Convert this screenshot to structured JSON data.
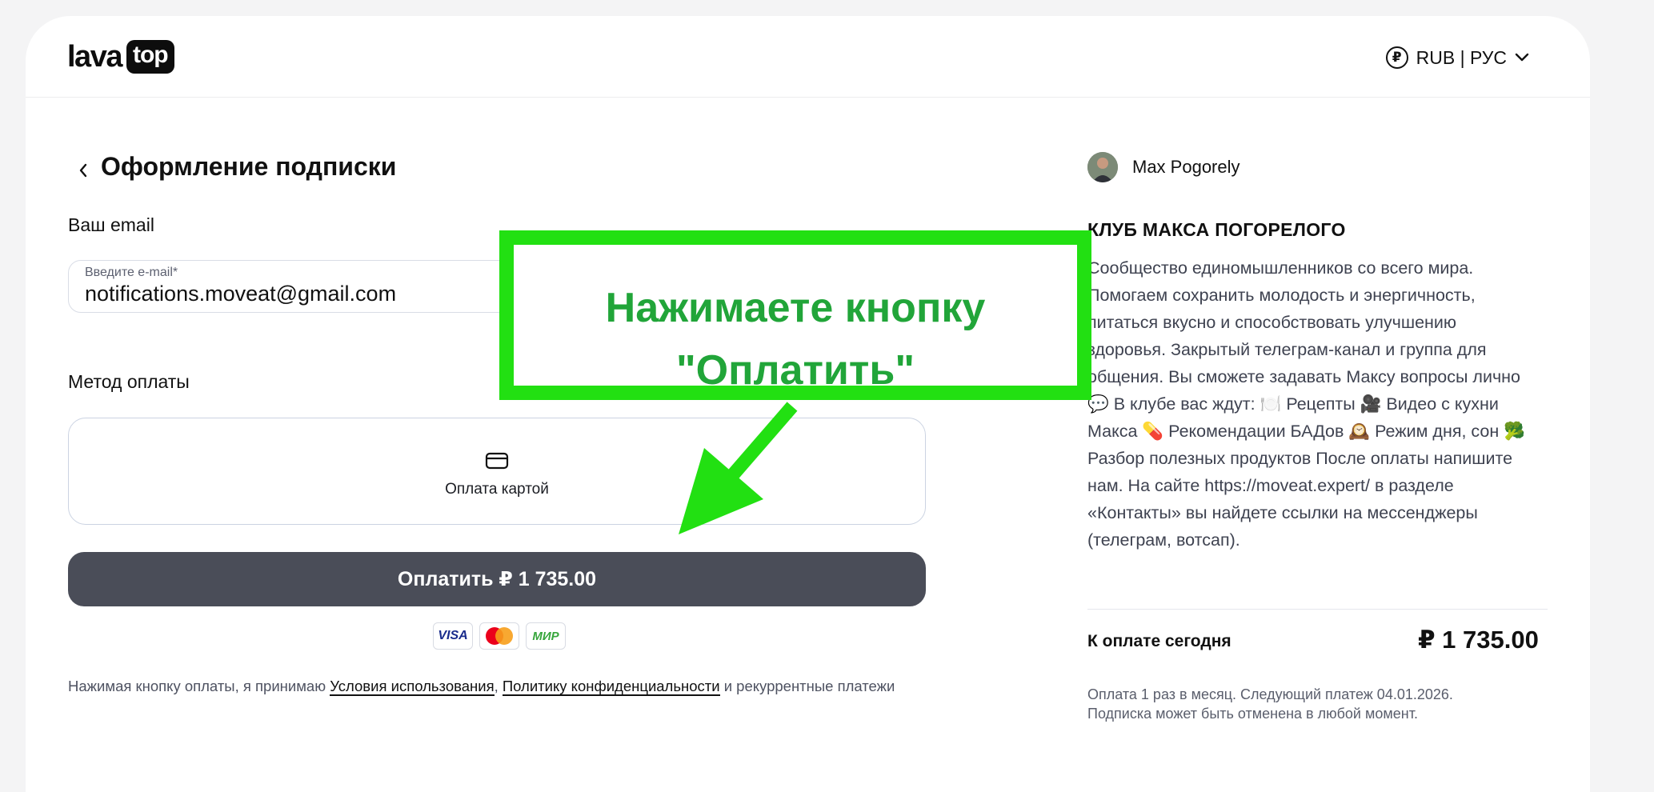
{
  "header": {
    "logo_word": "lava",
    "logo_badge": "top",
    "currency_symbol": "₽",
    "currency_label": "RUB | РУС"
  },
  "form": {
    "title": "Оформление подписки",
    "email_label": "Ваш email",
    "email_caption": "Введите e-mail*",
    "email_value": "notifications.moveat@gmail.com",
    "method_label": "Метод оплаты",
    "method_option": "Оплата картой",
    "pay_button": "Оплатить ₽ 1 735.00",
    "payment_logos": [
      "VISA",
      "Mastercard",
      "МИР"
    ],
    "terms_prefix": "Нажимая кнопку оплаты, я принимаю ",
    "terms_link1": "Условия использования",
    "terms_sep": ", ",
    "terms_link2": "Политику конфиденциальности",
    "terms_suffix": " и рекуррентные платежи"
  },
  "summary": {
    "author": "Max Pogorely",
    "club_title": "КЛУБ МАКСА ПОГОРЕЛОГО",
    "description": "Сообщество единомышленников со всего мира. Помогаем сохранить молодость и энергичность, питаться вкусно и способствовать улучшению здоровья. Закрытый телеграм-канал и группа для общения. Вы сможете задавать Максу вопросы лично 💬 В клубе вас ждут: 🍽️ Рецепты 🎥 Видео с кухни Макса 💊 Рекомендации БАДов 🕰️ Режим дня, сон 🥦 Разбор полезных продуктов После оплаты напишите нам. На сайте https://moveat.expert/ в разделе «Контакты» вы найдете ссылки на мессенджеры (телеграм, вотсап).",
    "due_label": "К оплате сегодня",
    "due_amount": "₽ 1 735.00",
    "note_line1": "Оплата 1 раз в месяц. Следующий платеж 04.01.2026.",
    "note_line2": "Подписка может быть отменена в любой момент."
  },
  "overlay": {
    "line1": "Нажимаете кнопку",
    "line2": "\"Оплатить\"",
    "colors": {
      "frame": "#22e012",
      "text": "#21a539"
    }
  },
  "colors": {
    "pay_button": "#4a4d58",
    "page_bg": "#f4f4f5"
  }
}
